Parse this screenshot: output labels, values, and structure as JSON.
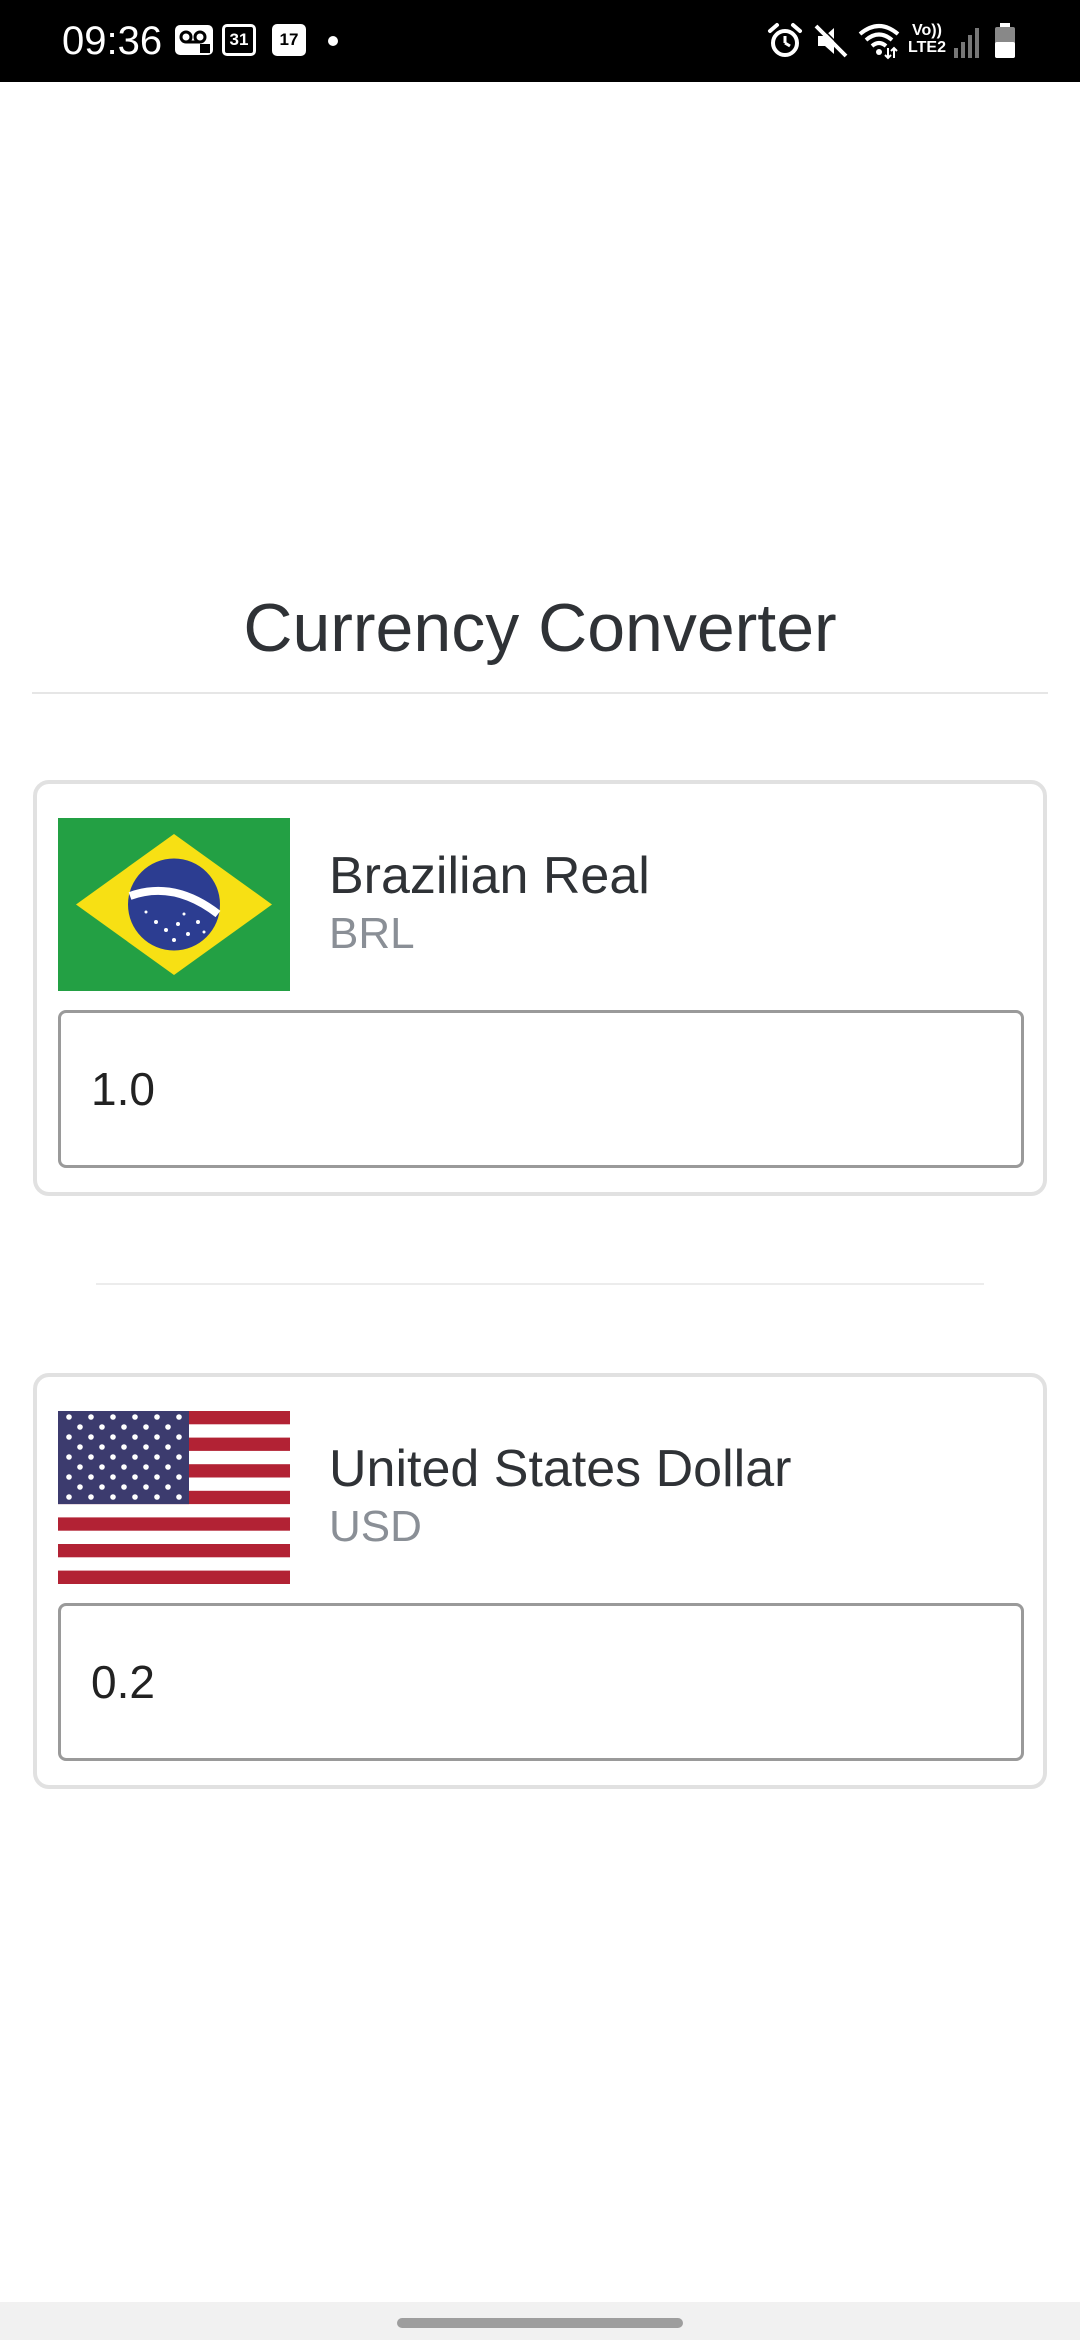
{
  "status_bar": {
    "time": "09:36",
    "calendar_day_1": "31",
    "calendar_day_2": "17",
    "network_label_top": "Vo))",
    "network_label_bottom": "LTE2",
    "icons": [
      "voicemail-icon",
      "calendar-icon",
      "calendar-icon",
      "notification-dot-icon",
      "alarm-icon",
      "mute-icon",
      "wifi-icon",
      "signal-icon",
      "battery-icon"
    ]
  },
  "app": {
    "title": "Currency Converter"
  },
  "from_currency": {
    "name": "Brazilian Real",
    "code": "BRL",
    "amount": "1.0",
    "flag": "brazil-flag-icon"
  },
  "to_currency": {
    "name": "United States Dollar",
    "code": "USD",
    "amount": "0.2",
    "flag": "usa-flag-icon"
  },
  "colors": {
    "title_text": "#2f3236",
    "code_text": "#8a8f96",
    "card_border": "#e1e1e1",
    "input_border": "#9a9a9a",
    "status_bar_bg": "#000000"
  }
}
